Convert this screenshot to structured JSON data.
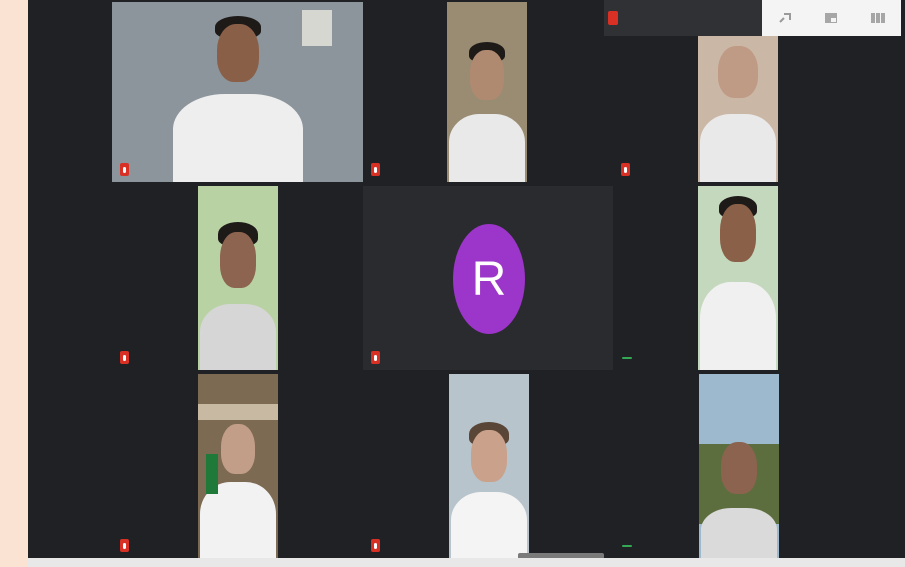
{
  "window": {
    "app": "Google Meet",
    "background_color": "#202124",
    "border_color": "#fbe3d3"
  },
  "notice": {
    "line1": "",
    "line2": ""
  },
  "controls": [
    {
      "name": "pin-icon"
    },
    {
      "name": "picture-in-picture-icon"
    },
    {
      "name": "layout-icon"
    }
  ],
  "participants": [
    {
      "name": "",
      "muted": true
    },
    {
      "name": "",
      "muted": true
    },
    {
      "name": "",
      "muted": true
    },
    {
      "name": "",
      "muted": true
    },
    {
      "name": "",
      "muted": true,
      "avatar_letter": "R",
      "avatar_color": "#9c35c9"
    },
    {
      "name": "",
      "muted": false
    },
    {
      "name": "",
      "muted": true
    },
    {
      "name": "",
      "muted": true
    },
    {
      "name": "",
      "muted": false
    }
  ]
}
